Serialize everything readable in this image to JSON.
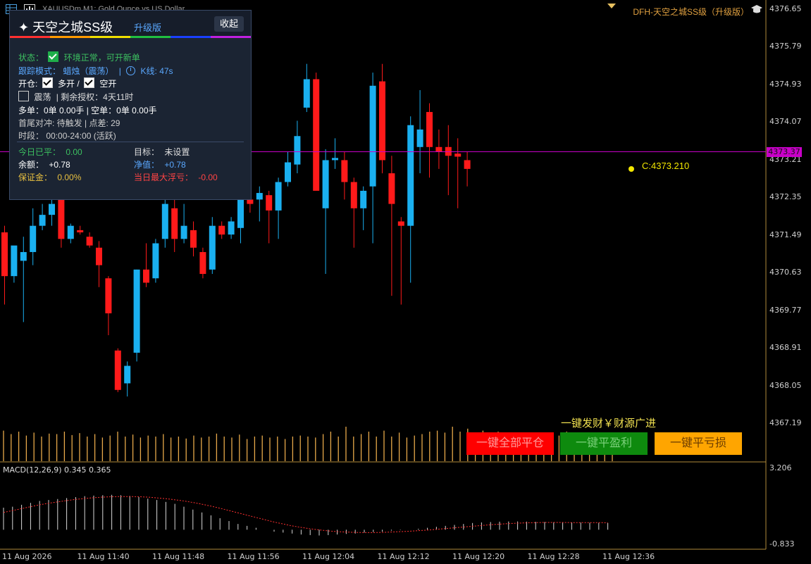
{
  "window": {
    "title": "XAUUSDm,M1: Gold Ounce vs US Dollar"
  },
  "indicator_name": "DFH-天空之城SS级（升级版）",
  "price_axis": [
    "4376.65",
    "4375.79",
    "4374.93",
    "4374.07",
    "4373.21",
    "4372.35",
    "4371.49",
    "4370.63",
    "4369.77",
    "4368.91",
    "4368.05",
    "4367.19"
  ],
  "current_price_tag": "4373.37",
  "close_label": "C:4373.210",
  "macd": {
    "label": "MACD(12,26,9) 0.345 0.365",
    "axis_top": "3.206",
    "axis_bottom": "-0.833"
  },
  "time_axis": [
    "11 Aug 2026",
    "11 Aug 11:40",
    "11 Aug 11:48",
    "11 Aug 11:56",
    "11 Aug 12:04",
    "11 Aug 12:12",
    "11 Aug 12:20",
    "11 Aug 12:28",
    "11 Aug 12:36"
  ],
  "panel": {
    "title": "✦ 天空之城SS级",
    "badge": "升级版",
    "collapse_label": "收起",
    "status_label": "状态：",
    "status_value": "环境正常，可开新单",
    "track_label": "跟踪模式：",
    "track_value": "蜡烛（震荡）",
    "track_sep": "|",
    "kline_value": "K线: 47s",
    "open_label": "开仓:",
    "long_label": "多开 /",
    "short_label": "空开",
    "range_label": "震荡",
    "license_label": "| 剩余授权：4天11时",
    "positions_line": "多单：0单 0.00手 | 空单：0单 0.00手",
    "hedge_line": "首尾对冲: 待触发 | 点差: 29",
    "session_line": "时段：  00:00-24:00 (活跃)",
    "today_closed_label": "今日已平：",
    "today_closed_value": "0.00",
    "target_label": "目标：",
    "target_value": "未设置",
    "balance_label": "余额：",
    "balance_value": "+0.78",
    "equity_label": "净值：",
    "equity_value": "+0.78",
    "margin_label": "保证金：",
    "margin_value": "0.00%",
    "max_float_label": "当日最大浮亏：",
    "max_float_value": "-0.00"
  },
  "buttons": {
    "close_all": "一键全部平仓",
    "close_profit": "一键平盈利",
    "close_loss": "一键平亏损"
  },
  "promo_text": "一键发财￥财源广进",
  "colors": {
    "bull": "#1ab0f0",
    "bear": "#ff1a1a",
    "volume": "#e8a94a",
    "price_line": "#c800c8"
  },
  "candles": [
    {
      "o": 4371.55,
      "h": 4371.7,
      "l": 4369.9,
      "c": 4370.55
    },
    {
      "o": 4370.55,
      "h": 4371.15,
      "l": 4370.4,
      "c": 4371.25
    },
    {
      "o": 4370.9,
      "h": 4371.45,
      "l": 4369.5,
      "c": 4371.1
    },
    {
      "o": 4371.1,
      "h": 4372.1,
      "l": 4370.8,
      "c": 4371.7
    },
    {
      "o": 4371.7,
      "h": 4372.2,
      "l": 4371.6,
      "c": 4371.95
    },
    {
      "o": 4371.95,
      "h": 4372.3,
      "l": 4371.7,
      "c": 4372.2
    },
    {
      "o": 4372.3,
      "h": 4372.45,
      "l": 4371.2,
      "c": 4371.4
    },
    {
      "o": 4371.4,
      "h": 4371.75,
      "l": 4371.3,
      "c": 4371.7
    },
    {
      "o": 4371.6,
      "h": 4371.7,
      "l": 4371.5,
      "c": 4371.55
    },
    {
      "o": 4371.45,
      "h": 4371.55,
      "l": 4371.2,
      "c": 4371.25
    },
    {
      "o": 4371.2,
      "h": 4371.35,
      "l": 4370.3,
      "c": 4370.8
    },
    {
      "o": 4370.5,
      "h": 4370.55,
      "l": 4369.2,
      "c": 4369.7
    },
    {
      "o": 4368.85,
      "h": 4368.9,
      "l": 4367.9,
      "c": 4367.95
    },
    {
      "o": 4368.1,
      "h": 4368.6,
      "l": 4367.8,
      "c": 4368.5
    },
    {
      "o": 4368.8,
      "h": 4370.7,
      "l": 4368.6,
      "c": 4370.7
    },
    {
      "o": 4370.7,
      "h": 4371.3,
      "l": 4370.3,
      "c": 4370.4
    },
    {
      "o": 4370.5,
      "h": 4371.4,
      "l": 4370.4,
      "c": 4371.3
    },
    {
      "o": 4371.4,
      "h": 4372.5,
      "l": 4371.2,
      "c": 4372.2
    },
    {
      "o": 4372.1,
      "h": 4372.3,
      "l": 4371.1,
      "c": 4371.4
    },
    {
      "o": 4371.4,
      "h": 4372.2,
      "l": 4371.3,
      "c": 4371.7
    },
    {
      "o": 4371.6,
      "h": 4371.8,
      "l": 4371.0,
      "c": 4371.2
    },
    {
      "o": 4371.1,
      "h": 4371.2,
      "l": 4370.5,
      "c": 4370.6
    },
    {
      "o": 4370.7,
      "h": 4371.9,
      "l": 4370.6,
      "c": 4371.7
    },
    {
      "o": 4371.7,
      "h": 4371.8,
      "l": 4371.4,
      "c": 4371.5
    },
    {
      "o": 4371.5,
      "h": 4371.9,
      "l": 4371.4,
      "c": 4371.8
    },
    {
      "o": 4371.65,
      "h": 4372.4,
      "l": 4371.3,
      "c": 4372.3
    },
    {
      "o": 4372.3,
      "h": 4372.5,
      "l": 4372.0,
      "c": 4372.2
    },
    {
      "o": 4372.3,
      "h": 4372.6,
      "l": 4371.8,
      "c": 4372.45
    },
    {
      "o": 4372.4,
      "h": 4372.5,
      "l": 4371.3,
      "c": 4372.05
    },
    {
      "o": 4372.05,
      "h": 4372.8,
      "l": 4371.4,
      "c": 4372.7
    },
    {
      "o": 4372.7,
      "h": 4373.4,
      "l": 4372.6,
      "c": 4373.15
    },
    {
      "o": 4373.1,
      "h": 4374.1,
      "l": 4372.9,
      "c": 4373.75
    },
    {
      "o": 4374.4,
      "h": 4375.4,
      "l": 4374.3,
      "c": 4375.05
    },
    {
      "o": 4375.05,
      "h": 4375.2,
      "l": 4372.7,
      "c": 4372.5
    },
    {
      "o": 4372.1,
      "h": 4373.45,
      "l": 4370.6,
      "c": 4373.2
    },
    {
      "o": 4373.2,
      "h": 4373.7,
      "l": 4373.0,
      "c": 4373.25
    },
    {
      "o": 4373.2,
      "h": 4373.4,
      "l": 4372.3,
      "c": 4372.7
    },
    {
      "o": 4372.7,
      "h": 4372.8,
      "l": 4371.2,
      "c": 4372.1
    },
    {
      "o": 4372.1,
      "h": 4372.6,
      "l": 4371.6,
      "c": 4372.5
    },
    {
      "o": 4372.6,
      "h": 4375.2,
      "l": 4371.3,
      "c": 4374.9
    },
    {
      "o": 4375.0,
      "h": 4375.4,
      "l": 4372.9,
      "c": 4373.2
    },
    {
      "o": 4372.9,
      "h": 4373.3,
      "l": 4370.1,
      "c": 4372.2
    },
    {
      "o": 4371.8,
      "h": 4371.9,
      "l": 4369.9,
      "c": 4371.7
    },
    {
      "o": 4371.7,
      "h": 4374.2,
      "l": 4370.4,
      "c": 4374.0
    },
    {
      "o": 4373.5,
      "h": 4374.8,
      "l": 4372.9,
      "c": 4373.9
    },
    {
      "o": 4374.3,
      "h": 4374.5,
      "l": 4372.8,
      "c": 4373.5
    },
    {
      "o": 4373.5,
      "h": 4373.9,
      "l": 4373.0,
      "c": 4373.4
    },
    {
      "o": 4373.5,
      "h": 4374.0,
      "l": 4372.4,
      "c": 4373.3
    },
    {
      "o": 4373.35,
      "h": 4373.7,
      "l": 4372.1,
      "c": 4373.28
    },
    {
      "o": 4373.2,
      "h": 4373.4,
      "l": 4372.6,
      "c": 4373.0
    }
  ],
  "volumes": [
    0.62,
    0.55,
    0.6,
    0.52,
    0.58,
    0.5,
    0.56,
    0.55,
    0.6,
    0.53,
    0.57,
    0.5,
    0.55,
    0.48,
    0.52,
    0.6,
    0.5,
    0.54,
    0.48,
    0.52,
    0.5,
    0.55,
    0.48,
    0.5,
    0.46,
    0.52,
    0.48,
    0.5,
    0.56,
    0.5,
    0.48,
    0.54,
    0.45,
    0.5,
    0.52,
    0.48,
    0.5,
    0.45,
    0.5,
    0.52,
    0.5,
    0.48,
    0.55,
    0.6,
    0.5,
    0.7,
    0.5,
    0.55,
    0.6,
    0.5,
    0.62,
    0.5,
    0.58,
    0.48,
    0.52,
    0.55,
    0.6,
    0.62,
    0.58,
    0.7,
    0.6,
    0.66,
    0.55,
    0.62,
    0.5,
    0.6,
    0.55,
    0.48,
    0.52,
    0.5,
    0.55,
    0.58,
    0.5,
    0.52,
    0.6,
    0.5,
    0.55,
    0.58,
    0.52,
    0.5,
    0.48
  ],
  "macd_hist": [
    1.15,
    1.2,
    1.3,
    1.4,
    1.5,
    1.55,
    1.6,
    1.65,
    1.7,
    1.75,
    1.78,
    1.8,
    1.82,
    1.8,
    1.76,
    1.7,
    1.62,
    1.55,
    1.45,
    1.35,
    1.2,
    1.05,
    0.9,
    0.75,
    0.6,
    0.45,
    0.3,
    0.2,
    0.1,
    0.0,
    -0.1,
    -0.15,
    -0.2,
    -0.25,
    -0.28,
    -0.3,
    -0.28,
    -0.25,
    -0.22,
    -0.2,
    -0.15,
    -0.12,
    -0.1,
    -0.05,
    -0.02,
    0.0,
    0.05,
    0.1,
    0.15,
    0.2,
    0.25,
    0.3,
    0.35,
    0.38,
    0.4,
    0.42,
    0.43,
    0.43,
    0.42,
    0.41,
    0.4,
    0.39,
    0.38,
    0.38,
    0.37,
    0.36,
    0.36,
    0.35
  ],
  "macd_signal": [
    0.9,
    1.0,
    1.1,
    1.2,
    1.3,
    1.38,
    1.45,
    1.52,
    1.58,
    1.63,
    1.67,
    1.7,
    1.72,
    1.73,
    1.73,
    1.72,
    1.7,
    1.66,
    1.62,
    1.56,
    1.5,
    1.42,
    1.33,
    1.23,
    1.12,
    1.0,
    0.88,
    0.76,
    0.64,
    0.52,
    0.4,
    0.3,
    0.2,
    0.12,
    0.05,
    -0.01,
    -0.06,
    -0.1,
    -0.12,
    -0.14,
    -0.15,
    -0.15,
    -0.14,
    -0.12,
    -0.1,
    -0.08,
    -0.05,
    -0.02,
    0.02,
    0.06,
    0.1,
    0.14,
    0.18,
    0.22,
    0.26,
    0.29,
    0.32,
    0.34,
    0.36,
    0.37,
    0.38,
    0.38,
    0.38,
    0.37,
    0.37,
    0.37,
    0.37,
    0.365
  ]
}
